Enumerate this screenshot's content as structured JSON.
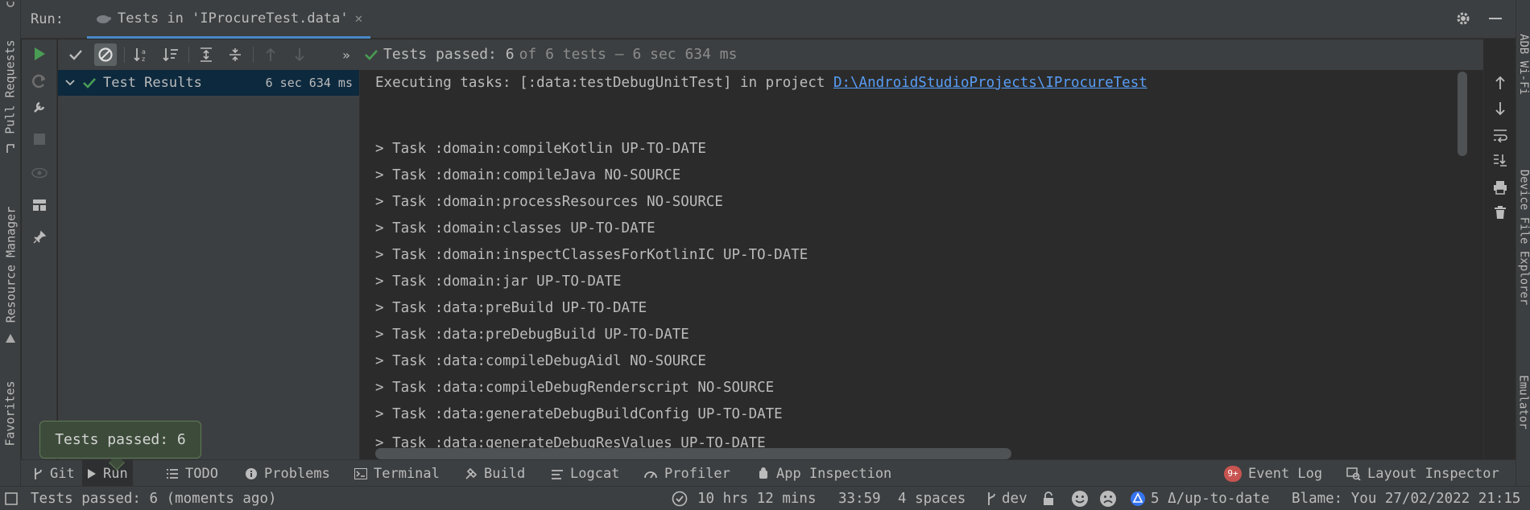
{
  "run_header": {
    "label": "Run:",
    "tab_title": "Tests in 'IProcureTest.data'",
    "close_glyph": "✕"
  },
  "toolbar": {
    "summary_pass": "Tests passed: 6",
    "summary_rest": "of 6 tests – 6 sec 634 ms",
    "more_glyph": "»"
  },
  "tree": {
    "root_label": "Test Results",
    "root_time": "6 sec 634 ms"
  },
  "console": {
    "header_prefix": "Executing tasks: [:data:testDebugUnitTest] in project ",
    "header_link": "D:\\AndroidStudioProjects\\IProcureTest",
    "lines": [
      "> Task :domain:compileKotlin UP-TO-DATE",
      "> Task :domain:compileJava NO-SOURCE",
      "> Task :domain:processResources NO-SOURCE",
      "> Task :domain:classes UP-TO-DATE",
      "> Task :domain:inspectClassesForKotlinIC UP-TO-DATE",
      "> Task :domain:jar UP-TO-DATE",
      "> Task :data:preBuild UP-TO-DATE",
      "> Task :data:preDebugBuild UP-TO-DATE",
      "> Task :data:compileDebugAidl NO-SOURCE",
      "> Task :data:compileDebugRenderscript NO-SOURCE",
      "> Task :data:generateDebugBuildConfig UP-TO-DATE",
      "> Task :data:generateDebugResValues UP-TO-DATE"
    ]
  },
  "left_stripe": {
    "pull_requests": "Pull Requests",
    "resource_manager": "Resource Manager",
    "favorites": "Favorites"
  },
  "right_stripe": {
    "adb_wifi": "ADB Wi-Fi",
    "device_file_explorer": "Device File Explorer",
    "emulator": "Emulator"
  },
  "tool_windows": {
    "git": "Git",
    "run": "Run",
    "todo": "TODO",
    "problems": "Problems",
    "terminal": "Terminal",
    "build": "Build",
    "logcat": "Logcat",
    "profiler": "Profiler",
    "app_inspection": "App Inspection",
    "event_log": "Event Log",
    "event_badge": "9+",
    "layout_inspector": "Layout Inspector"
  },
  "tooltip": {
    "text": "Tests passed: 6"
  },
  "status": {
    "message": "Tests passed: 6 (moments ago)",
    "time_tracked": "10 hrs 12 mins",
    "caret": "33:59",
    "indent": "4 spaces",
    "branch": "dev",
    "vcs_status": "5 Δ/up-to-date",
    "blame": "Blame: You 27/02/2022 21:15"
  },
  "colors": {
    "accent_green": "#499c54",
    "link_blue": "#589df6",
    "badge_red": "#c75450"
  }
}
